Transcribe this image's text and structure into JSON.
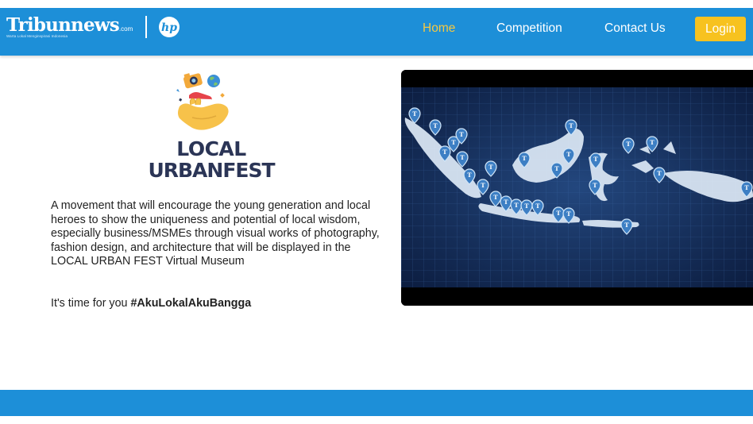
{
  "header": {
    "brand": {
      "tribun_name": "Tribunnews",
      "tribun_suffix": ".com",
      "tribun_tagline": "Warta Lokal Menginspirasi Indonesia",
      "partner_logo": "hp"
    },
    "nav": {
      "home": "Home",
      "competition": "Competition",
      "contact": "Contact Us"
    },
    "login_label": "Login",
    "colors": {
      "bar": "#1d8fd8",
      "active_link": "#f5c842",
      "login_bg": "#f7c21f"
    }
  },
  "hero": {
    "logo_line1": "LOCAL",
    "logo_line2": "URBANFEST",
    "description": "A movement that will encourage the young generation and local heroes to show the uniqueness and potential of local wisdom, especially business/MSMEs through visual works of photography, fashion design, and architecture that will be displayed in the LOCAL URBAN FEST Virtual Museum",
    "cta_prefix": "It's time for you",
    "cta_hashtag": "#AkuLokalAkuBangga"
  },
  "video": {
    "content": "map-of-indonesia-with-pins",
    "pin_icon": "t-map-pin-icon"
  },
  "footer": {
    "color": "#1d8fd8"
  }
}
